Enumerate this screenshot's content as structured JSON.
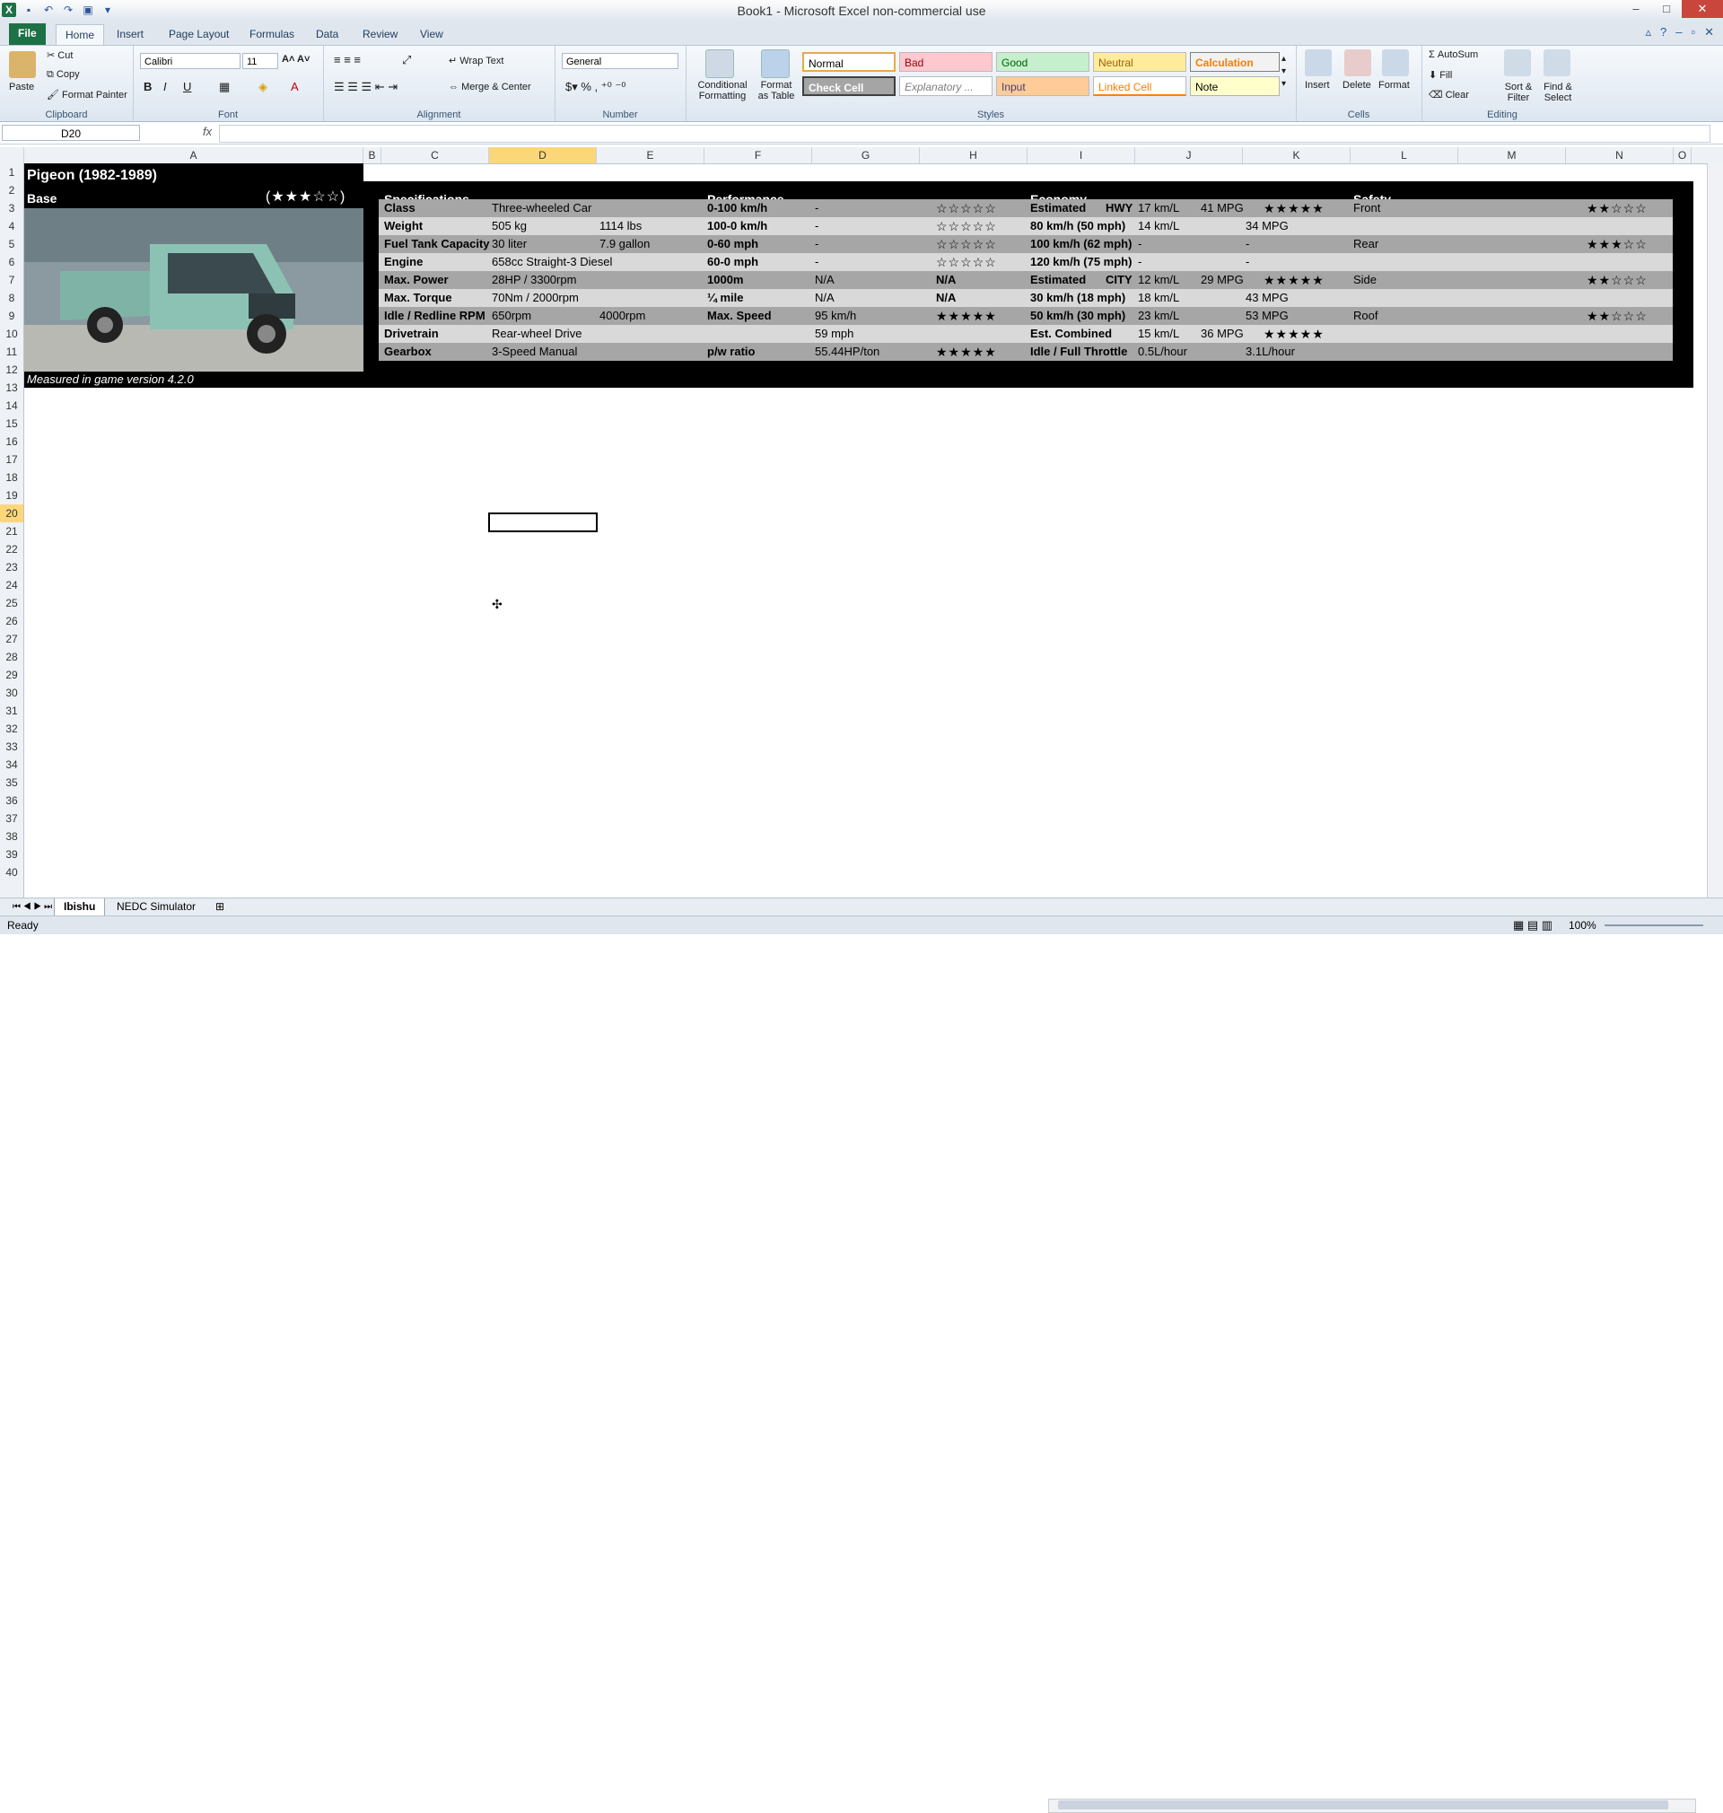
{
  "window": {
    "title": "Book1 - Microsoft Excel non-commercial use"
  },
  "ribbon_tabs": [
    "File",
    "Home",
    "Insert",
    "Page Layout",
    "Formulas",
    "Data",
    "Review",
    "View"
  ],
  "clipboard": {
    "paste": "Paste",
    "cut": "Cut",
    "copy": "Copy",
    "format_painter": "Format Painter",
    "label": "Clipboard"
  },
  "font": {
    "family": "Calibri",
    "size": "11",
    "label": "Font"
  },
  "alignment": {
    "wrap": "Wrap Text",
    "merge": "Merge & Center",
    "label": "Alignment"
  },
  "number": {
    "format": "General",
    "label": "Number"
  },
  "styles": {
    "conditional": "Conditional Formatting",
    "format_table": "Format as Table",
    "normal": "Normal",
    "bad": "Bad",
    "good": "Good",
    "neutral": "Neutral",
    "calculation": "Calculation",
    "check": "Check Cell",
    "explanatory": "Explanatory ...",
    "input": "Input",
    "linked": "Linked Cell",
    "note": "Note",
    "label": "Styles"
  },
  "cells_grp": {
    "insert": "Insert",
    "delete": "Delete",
    "format": "Format",
    "label": "Cells"
  },
  "editing": {
    "autosum": "AutoSum",
    "fill": "Fill",
    "clear": "Clear",
    "sort": "Sort & Filter",
    "find": "Find & Select",
    "label": "Editing"
  },
  "formula_bar": {
    "namebox": "D20",
    "fx": "fx",
    "value": ""
  },
  "columns": [
    "A",
    "B",
    "C",
    "D",
    "E",
    "F",
    "G",
    "H",
    "I",
    "J",
    "K",
    "L",
    "M",
    "N",
    "O"
  ],
  "rows": [
    "1",
    "2",
    "3",
    "4",
    "5",
    "6",
    "7",
    "8",
    "9",
    "10",
    "11",
    "12",
    "13",
    "14",
    "15",
    "16",
    "17",
    "18",
    "19",
    "20",
    "21",
    "22",
    "23",
    "24",
    "25",
    "26",
    "27",
    "28",
    "29",
    "30",
    "31",
    "32",
    "33",
    "34",
    "35",
    "36",
    "37",
    "38",
    "39",
    "40"
  ],
  "sheet": {
    "title": "Pigeon (1982-1989)",
    "variant": "Base",
    "rating": "(★★★☆☆)",
    "footnote": "Measured in game version 4.2.0",
    "headers": {
      "spec": "Specifications",
      "perf": "Performance",
      "econ": "Economy",
      "safety": "Safety"
    },
    "spec_rows": [
      {
        "k": "Class",
        "v1": "Three-wheeled Car",
        "v2": ""
      },
      {
        "k": "Weight",
        "v1": "505 kg",
        "v2": "1114 lbs"
      },
      {
        "k": "Fuel Tank Capacity",
        "v1": "30 liter",
        "v2": "7.9 gallon"
      },
      {
        "k": "Engine",
        "v1": "658cc Straight-3 Diesel",
        "v2": ""
      },
      {
        "k": "Max. Power",
        "v1": "28HP / 3300rpm",
        "v2": ""
      },
      {
        "k": "Max. Torque",
        "v1": "70Nm / 2000rpm",
        "v2": ""
      },
      {
        "k": "Idle / Redline RPM",
        "v1": "650rpm",
        "v2": "4000rpm"
      },
      {
        "k": "Drivetrain",
        "v1": "Rear-wheel Drive",
        "v2": ""
      },
      {
        "k": "Gearbox",
        "v1": "3-Speed Manual",
        "v2": ""
      }
    ],
    "perf_rows": [
      {
        "k": "0-100 km/h",
        "v": "-",
        "s": "☆☆☆☆☆"
      },
      {
        "k": "100-0 km/h",
        "v": "-",
        "s": "☆☆☆☆☆"
      },
      {
        "k": "0-60 mph",
        "v": "-",
        "s": "☆☆☆☆☆"
      },
      {
        "k": "60-0 mph",
        "v": "-",
        "s": "☆☆☆☆☆"
      },
      {
        "k": "1000m",
        "v": "N/A",
        "s": "N/A"
      },
      {
        "k": "¼ mile",
        "v": "N/A",
        "s": "N/A"
      },
      {
        "k": "Max. Speed",
        "v": "95 km/h",
        "s": "★★★★★"
      },
      {
        "k": "",
        "v": "59 mph",
        "s": ""
      },
      {
        "k": "p/w ratio",
        "v": "55.44HP/ton",
        "s": "★★★★★"
      }
    ],
    "econ_rows": [
      {
        "k": "Estimated",
        "k2": "HWY",
        "v1": "17 km/L",
        "v2": "41 MPG",
        "s": "★★★★★"
      },
      {
        "k": "80 km/h  (50 mph)",
        "k2": "",
        "v1": "14 km/L",
        "v2": "",
        "v3": "34 MPG",
        "s": ""
      },
      {
        "k": "100 km/h (62 mph)",
        "k2": "",
        "v1": "-",
        "v2": "",
        "v3": "-",
        "s": ""
      },
      {
        "k": "120 km/h (75 mph)",
        "k2": "",
        "v1": "-",
        "v2": "",
        "v3": "-",
        "s": ""
      },
      {
        "k": "Estimated",
        "k2": "CITY",
        "v1": "12 km/L",
        "v2": "29 MPG",
        "s": "★★★★★"
      },
      {
        "k": "30 km/h    (18 mph)",
        "k2": "",
        "v1": "18 km/L",
        "v2": "",
        "v3": "43 MPG",
        "s": ""
      },
      {
        "k": "50 km/h    (30 mph)",
        "k2": "",
        "v1": "23 km/L",
        "v2": "",
        "v3": "53 MPG",
        "s": ""
      },
      {
        "k": "Est. Combined",
        "k2": "",
        "v1": "15 km/L",
        "v2": "36 MPG",
        "s": "★★★★★"
      },
      {
        "k": "Idle / Full Throttle",
        "k2": "",
        "v1": "0.5L/hour",
        "v2": "",
        "v3": "3.1L/hour",
        "s": ""
      }
    ],
    "safety_rows": [
      {
        "k": "Front",
        "s": "★★☆☆☆"
      },
      {
        "k": "",
        "s": ""
      },
      {
        "k": "Rear",
        "s": "★★★☆☆"
      },
      {
        "k": "",
        "s": ""
      },
      {
        "k": "Side",
        "s": "★★☆☆☆"
      },
      {
        "k": "",
        "s": ""
      },
      {
        "k": "Roof",
        "s": "★★☆☆☆"
      },
      {
        "k": "",
        "s": ""
      },
      {
        "k": "",
        "s": ""
      }
    ]
  },
  "sheet_tabs": [
    "Ibishu",
    "NEDC Simulator"
  ],
  "status": {
    "ready": "Ready",
    "zoom": "100%"
  }
}
